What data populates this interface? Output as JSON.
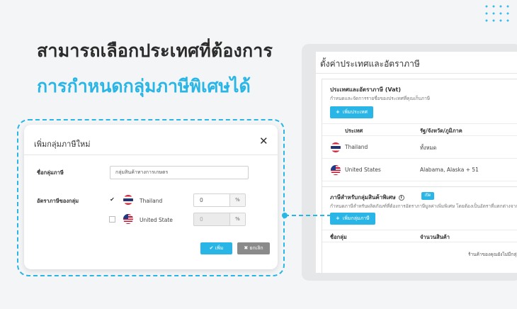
{
  "headline": {
    "line1": "สามารถเลือกประเทศที่ต้องการ",
    "line2": "การกำหนดกลุ่มภาษีพิเศษได้"
  },
  "colors": {
    "accent": "#29b6e6",
    "cancel": "#8a8a8a"
  },
  "tax_settings": {
    "title": "ตั้งค่าประเทศและอัตราภาษี",
    "vat": {
      "title": "ประเทศและอัตราภาษี (Vat)",
      "desc": "กำหนดและจัดการรายชื่อของประเทศที่คุณเก็บภาษี",
      "add_country_label": "เพิ่มประเทศ",
      "columns": [
        "ประเทศ",
        "รัฐ/จังหวัด/ภูมิภาค"
      ],
      "rows": [
        {
          "country": "Thailand",
          "region": "ทั้งหมด",
          "flag": "thailand-flag-icon"
        },
        {
          "country": "United States",
          "region": "Alabama, Alaska + 51",
          "flag": "us-flag-icon"
        }
      ]
    },
    "special": {
      "title": "ภาษีสำหรับกลุ่มสินค้าพิเศษ",
      "toggle_label": "เปิด",
      "desc": "กำหนดภาษีสำหรับผลิตภัณฑ์ที่ต้องการอัตราภาษีมูลค่าเพิ่มพิเศษ โดยต้องเป็นอัตราที่แตกต่างจากอัตรา",
      "add_group_label": "เพิ่มกลุ่มภาษี",
      "columns": [
        "ชื่อกลุ่ม",
        "จำนวนสินค้า"
      ],
      "empty_text": "ร้านค้าของคุณยังไม่มีกลุ่ม"
    }
  },
  "modal": {
    "title": "เพิ่มกลุ่มภาษีใหม่",
    "group_name_label": "ชื่อกลุ่มภาษี",
    "group_name_value": "กลุ่มสินค้าทางการเกษตร",
    "rate_label": "อัตราภาษีของกลุ่ม",
    "countries": [
      {
        "name": "Thailand",
        "checked": true,
        "rate": "0",
        "unit": "%"
      },
      {
        "name": "United State",
        "checked": false,
        "rate": "0",
        "unit": "%"
      }
    ],
    "save_label": "เพิ่ม",
    "cancel_label": "ยกเลิก"
  }
}
